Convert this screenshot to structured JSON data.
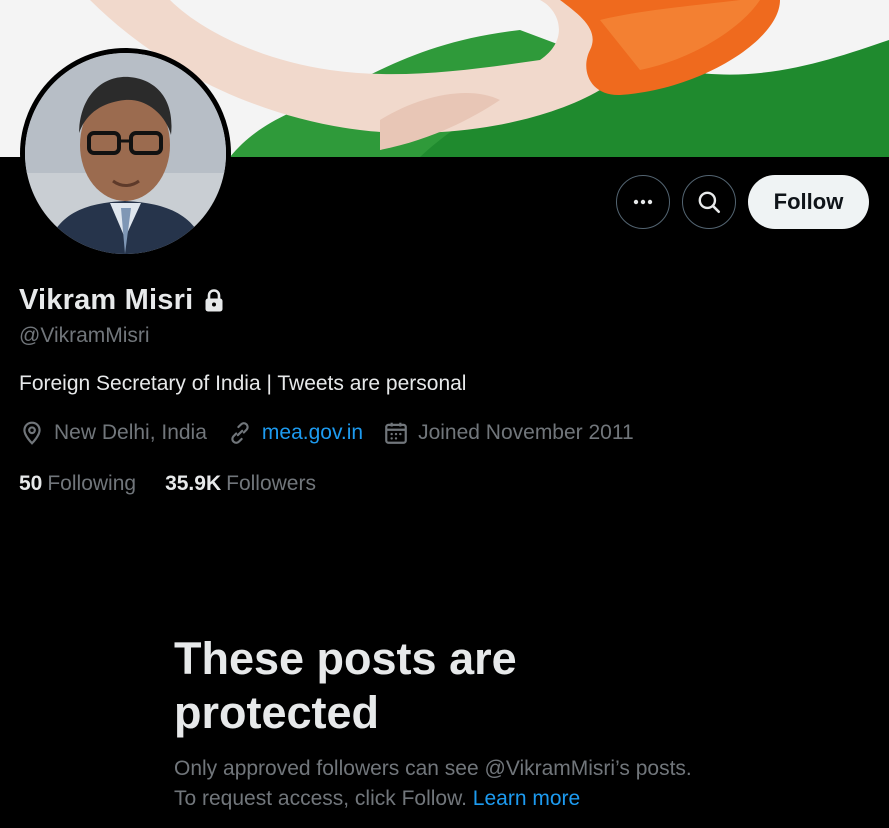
{
  "header": {
    "banner_image": "banner-tricolor-hand",
    "avatar_image": "profile-photo"
  },
  "actions": {
    "more_icon": "more-horizontal-icon",
    "search_icon": "search-icon",
    "follow_label": "Follow"
  },
  "profile": {
    "name": "Vikram Misri",
    "protected_icon": "lock-icon",
    "handle": "@VikramMisri",
    "bio": "Foreign Secretary of India | Tweets are personal",
    "location": "New Delhi, India",
    "website": "mea.gov.in",
    "joined": "Joined November 2011",
    "following_count": "50",
    "following_label": "Following",
    "followers_count": "35.9K",
    "followers_label": "Followers"
  },
  "protected_notice": {
    "title": "These posts are protected",
    "body": "Only approved followers can see @VikramMisri’s posts. To request access, click Follow.",
    "learn_more": "Learn more"
  },
  "colors": {
    "background": "#000000",
    "text_primary": "#e7e9ea",
    "text_secondary": "#71767b",
    "link": "#1d9bf0",
    "follow_button_bg": "#eff3f4"
  }
}
